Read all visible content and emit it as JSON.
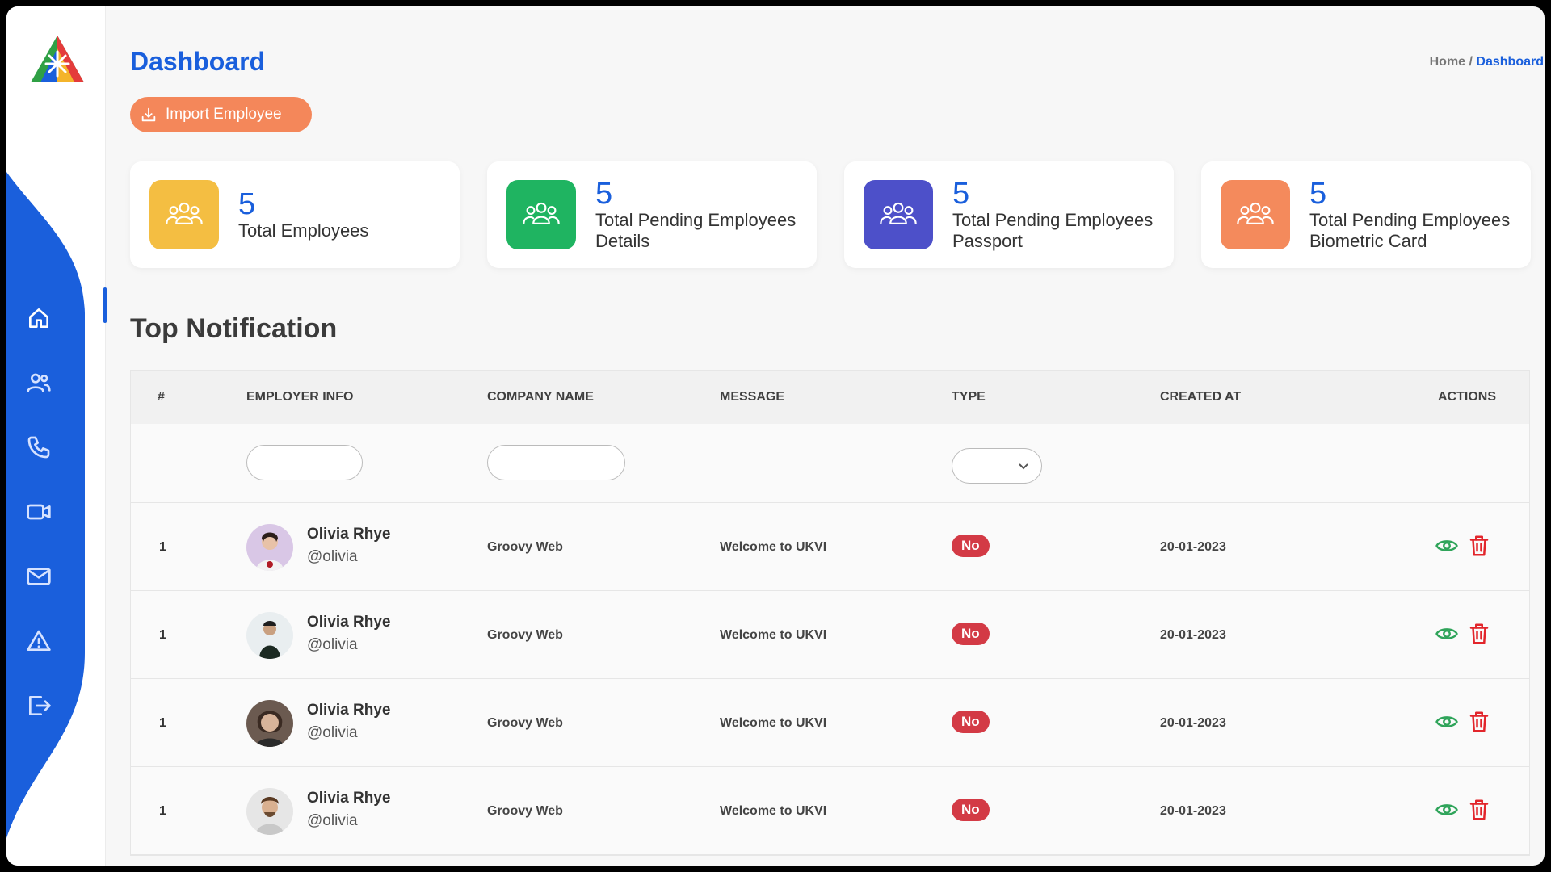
{
  "header": {
    "title": "Dashboard",
    "breadcrumb": {
      "home": "Home",
      "separator": " / ",
      "current": "Dashboard"
    },
    "import_button": "Import Employee"
  },
  "sidebar": {
    "items": [
      {
        "icon": "home-icon",
        "active": true
      },
      {
        "icon": "users-icon",
        "active": false
      },
      {
        "icon": "phone-icon",
        "active": false
      },
      {
        "icon": "video-icon",
        "active": false
      },
      {
        "icon": "mail-icon",
        "active": false
      },
      {
        "icon": "warning-icon",
        "active": false
      },
      {
        "icon": "logout-icon",
        "active": false
      }
    ],
    "accent": "#1a5fdc"
  },
  "cards": [
    {
      "count": "5",
      "label": "Total Employees",
      "color": "#f4be42"
    },
    {
      "count": "5",
      "label": "Total Pending Employees Details",
      "color": "#1fb461"
    },
    {
      "count": "5",
      "label": "Total Pending Employees Passport",
      "color": "#4d50c9"
    },
    {
      "count": "5",
      "label": "Total Pending Employees Biometric Card",
      "color": "#f48a5c"
    }
  ],
  "section_title": "Top Notification",
  "table": {
    "columns": [
      "#",
      "EMPLOYER INFO",
      "COMPANY NAME",
      "MESSAGE",
      "TYPE",
      "CREATED AT",
      "ACTIONS"
    ],
    "rows": [
      {
        "num": "1",
        "name": "Olivia Rhye",
        "handle": "@olivia",
        "company": "Groovy Web",
        "message": "Welcome to UKVI",
        "type": "No",
        "created": "20-01-2023"
      },
      {
        "num": "1",
        "name": "Olivia Rhye",
        "handle": "@olivia",
        "company": "Groovy Web",
        "message": "Welcome to UKVI",
        "type": "No",
        "created": "20-01-2023"
      },
      {
        "num": "1",
        "name": "Olivia Rhye",
        "handle": "@olivia",
        "company": "Groovy Web",
        "message": "Welcome to UKVI",
        "type": "No",
        "created": "20-01-2023"
      },
      {
        "num": "1",
        "name": "Olivia Rhye",
        "handle": "@olivia",
        "company": "Groovy Web",
        "message": "Welcome to UKVI",
        "type": "No",
        "created": "20-01-2023"
      }
    ]
  },
  "colors": {
    "primary": "#1a5fdc",
    "import": "#f4875a",
    "badge": "#d33a45",
    "view": "#2fa45a",
    "delete": "#e2252b"
  }
}
